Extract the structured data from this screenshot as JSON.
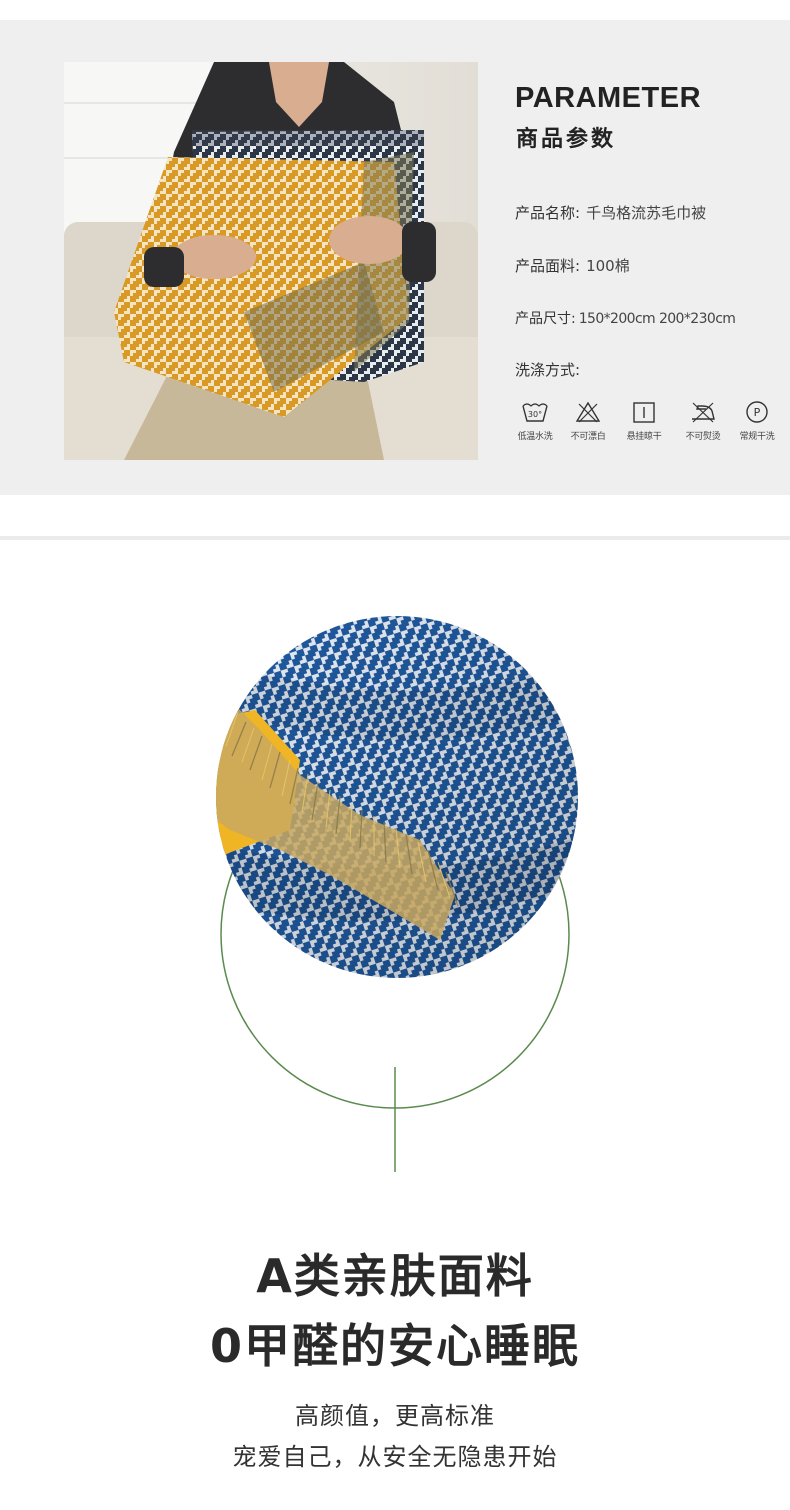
{
  "parameter": {
    "title": "PARAMETER",
    "subtitle": "商品参数",
    "specs": [
      {
        "label": "产品名称:",
        "value": "千鸟格流苏毛巾被"
      },
      {
        "label": "产品面料:",
        "value": "100棉"
      },
      {
        "label": "产品尺寸:",
        "value": "150*200cm  200*230cm"
      },
      {
        "label": "洗涤方式:",
        "value": ""
      }
    ],
    "care": [
      {
        "icon": "wash-30-icon",
        "label": "低温水洗",
        "mark": "30°"
      },
      {
        "icon": "no-bleach-icon",
        "label": "不可漂白"
      },
      {
        "icon": "hang-dry-icon",
        "label": "悬挂晾干"
      },
      {
        "icon": "no-iron-icon",
        "label": "不可熨烫"
      },
      {
        "icon": "dry-clean-icon",
        "label": "常规干洗",
        "mark": "P"
      }
    ]
  },
  "feature": {
    "headline_1": "A类亲肤面料",
    "headline_2": "0甲醛的安心睡眠",
    "subline_1": "高颜值，更高标准",
    "subline_2": "宠爱自己，从安全无隐患开始"
  },
  "colors": {
    "panel_bg": "#efefef",
    "accent_green": "#5a8a4e",
    "houndstooth_blue": "#1f5aa0",
    "mustard": "#e0a62e",
    "charcoal": "#2a3340"
  }
}
